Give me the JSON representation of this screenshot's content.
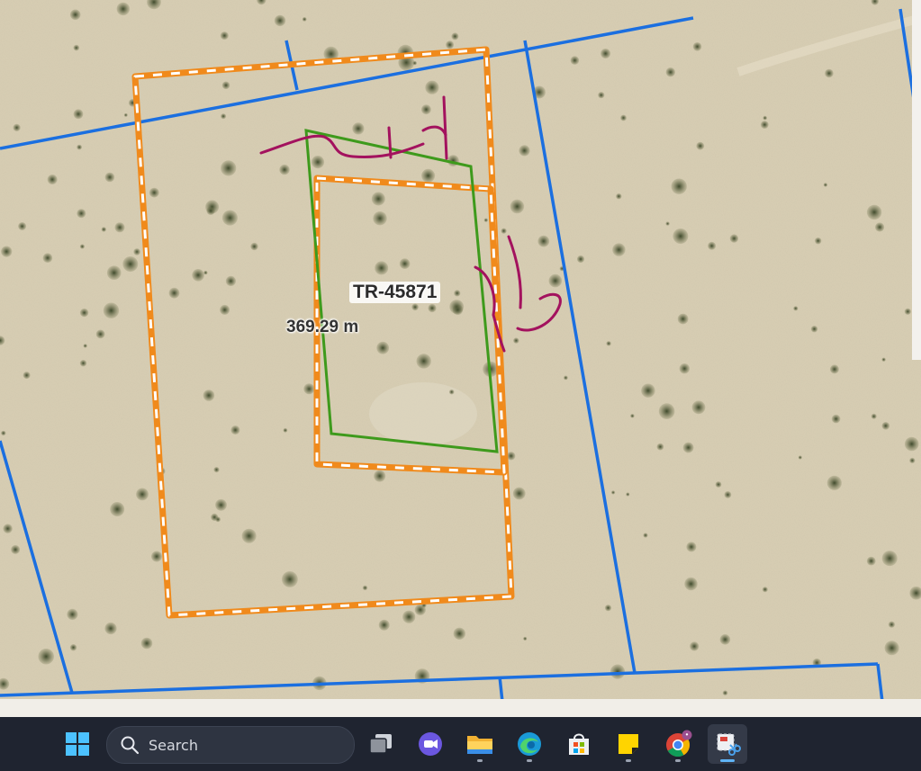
{
  "map": {
    "parcel_label": "TR-45871",
    "measurement_label": "369.29 m",
    "colors": {
      "parcel_lines": "#1b6fe0",
      "dashed_boundary": "#f08a1c",
      "dashed_boundary_alt": "#ffffff",
      "green_outline": "#3e9a1c",
      "markup_ink": "#a3125e"
    }
  },
  "taskbar": {
    "search_placeholder": "Search",
    "apps": [
      {
        "name": "task-view",
        "icon": "task-view-icon"
      },
      {
        "name": "meet",
        "icon": "video-chat-icon"
      },
      {
        "name": "file-explorer",
        "icon": "folder-icon"
      },
      {
        "name": "edge",
        "icon": "edge-browser-icon"
      },
      {
        "name": "store",
        "icon": "store-icon"
      },
      {
        "name": "sticky-notes",
        "icon": "sticky-note-icon"
      },
      {
        "name": "chrome",
        "icon": "chrome-icon"
      },
      {
        "name": "snipping-tool",
        "icon": "snipping-tool-icon"
      }
    ],
    "chrome_badge": "•"
  }
}
